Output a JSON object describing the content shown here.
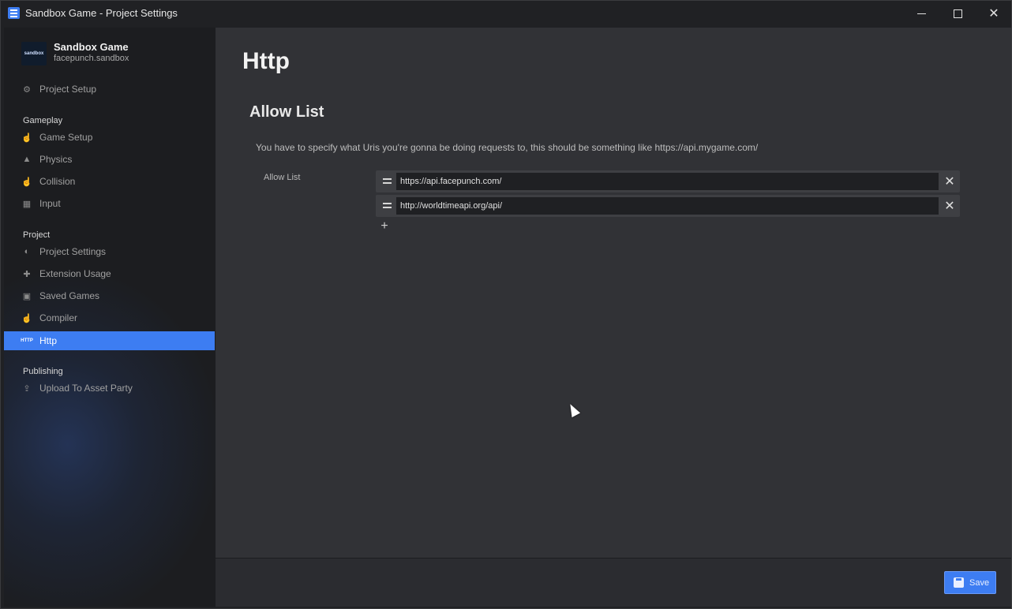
{
  "window": {
    "title": "Sandbox Game - Project Settings",
    "icon": "settings-sliders-icon",
    "controls": [
      "minimize-icon",
      "maximize-icon",
      "close-icon"
    ]
  },
  "project": {
    "thumb_text": "sandbox",
    "name": "Sandbox Game",
    "ident": "facepunch.sandbox"
  },
  "sidebar": {
    "top_items": [
      {
        "label": "Project Setup",
        "icon": "gear-icon"
      }
    ],
    "sections": [
      {
        "heading": "Gameplay",
        "items": [
          {
            "label": "Game Setup",
            "icon": "pointer-hand-icon"
          },
          {
            "label": "Physics",
            "icon": "shapes-icon"
          },
          {
            "label": "Collision",
            "icon": "pointer-hand-icon"
          },
          {
            "label": "Input",
            "icon": "keyboard-icon"
          }
        ]
      },
      {
        "heading": "Project",
        "items": [
          {
            "label": "Project Settings",
            "icon": "toggle-icon"
          },
          {
            "label": "Extension Usage",
            "icon": "puzzle-icon"
          },
          {
            "label": "Saved Games",
            "icon": "floppy-disk-icon"
          },
          {
            "label": "Compiler",
            "icon": "pointer-hand-icon"
          },
          {
            "label": "Http",
            "icon": "http-icon",
            "icon_text": "HTTP",
            "active": true
          }
        ]
      },
      {
        "heading": "Publishing",
        "items": [
          {
            "label": "Upload To Asset Party",
            "icon": "upload-file-icon"
          }
        ]
      }
    ]
  },
  "main": {
    "page_title": "Http",
    "section_title": "Allow List",
    "description": "You have to specify what Uris you're gonna be doing requests to, this should be something like https://api.mygame.com/",
    "field_label": "Allow List",
    "allow_list": [
      "https://api.facepunch.com/",
      "http://worldtimeapi.org/api/"
    ],
    "add_symbol": "+",
    "remove_symbol": "✕"
  },
  "footer": {
    "save_label": "Save"
  },
  "colors": {
    "accent": "#3d7df2",
    "sidebar_bg": "#1c1d20",
    "content_bg": "#313236"
  }
}
